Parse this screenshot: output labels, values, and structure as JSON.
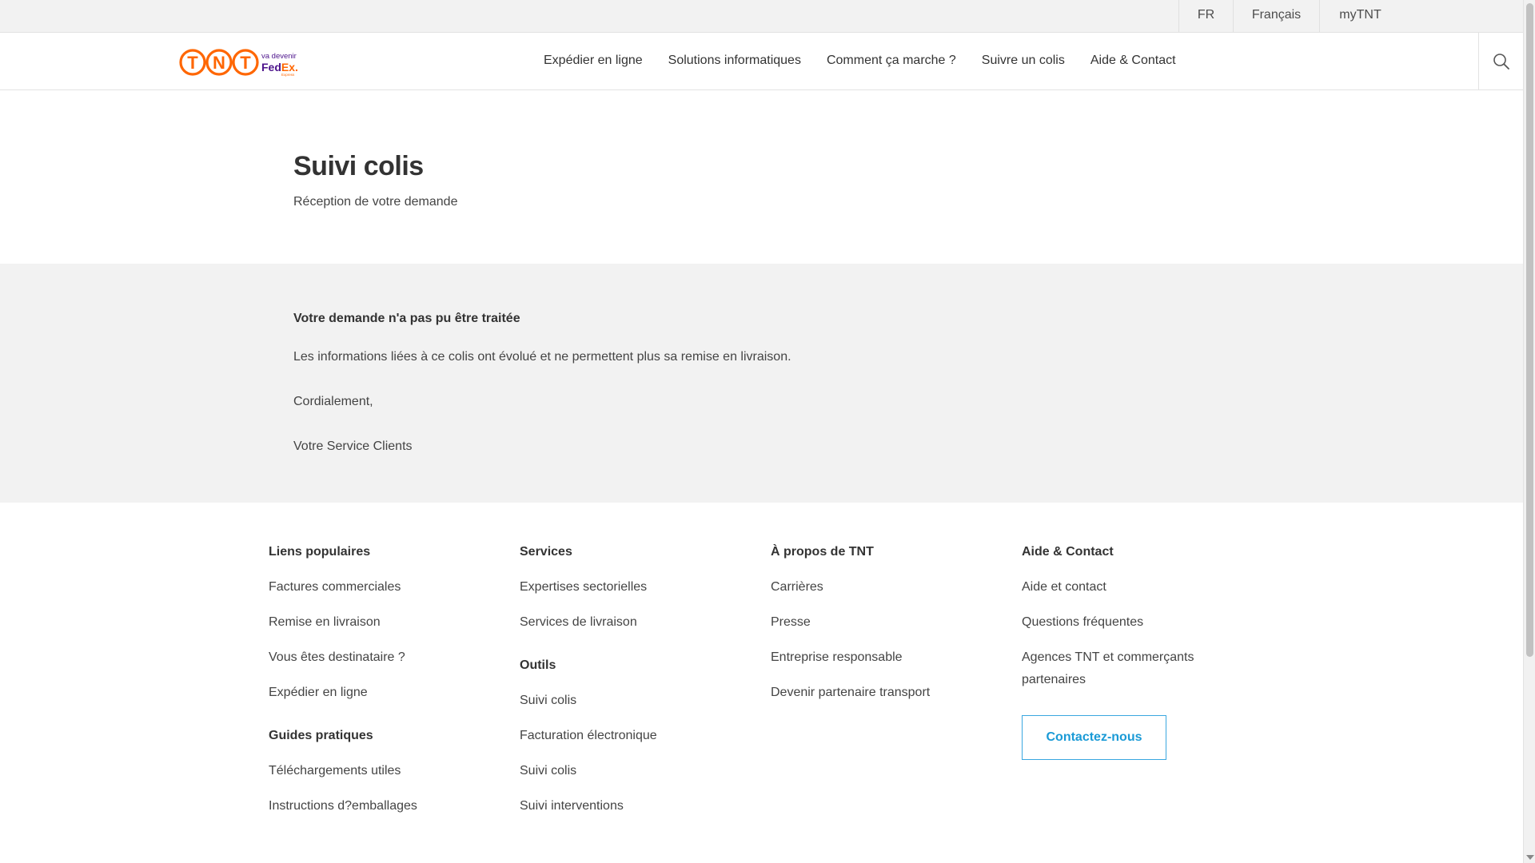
{
  "utility": {
    "country": "FR",
    "language": "Français",
    "account": "myTNT"
  },
  "header": {
    "logo": {
      "brand_text": "TNT",
      "tagline": "va devenir",
      "partner": "FedEx",
      "partner_sub": "Express"
    },
    "nav": [
      {
        "label": "Expédier en ligne"
      },
      {
        "label": "Solutions informatiques"
      },
      {
        "label": "Comment ça marche ?"
      },
      {
        "label": "Suivre un colis"
      },
      {
        "label": "Aide & Contact"
      }
    ],
    "search_icon": "search-icon"
  },
  "page": {
    "title": "Suivi colis",
    "subtitle": "Réception de votre demande"
  },
  "message": {
    "title": "Votre demande n'a pas pu être traitée",
    "text": "Les informations liées à ce colis ont évolué et ne permettent plus sa remise en livraison.",
    "greeting": "Cordialement,",
    "signature": "Votre Service Clients"
  },
  "footer": {
    "col1": {
      "heading": "Liens populaires",
      "links": [
        "Factures commerciales",
        "Remise en livraison",
        "Vous êtes destinataire ?",
        "Expédier en ligne"
      ],
      "heading2": "Guides pratiques",
      "links2": [
        "Téléchargements utiles",
        "Instructions d?emballages"
      ]
    },
    "col2": {
      "heading": "Services",
      "links": [
        "Expertises sectorielles",
        "Services de livraison"
      ],
      "heading2": "Outils",
      "links2": [
        "Suivi colis",
        "Facturation électronique",
        "Suivi colis",
        "Suivi interventions"
      ]
    },
    "col3": {
      "heading": "À propos de TNT",
      "links": [
        "Carrières",
        "Presse",
        "Entreprise responsable",
        "Devenir partenaire transport"
      ]
    },
    "col4": {
      "heading": "Aide & Contact",
      "links": [
        "Aide et contact",
        "Questions fréquentes",
        "Agences TNT et commerçants partenaires"
      ],
      "button": "Contactez-nous"
    }
  },
  "colors": {
    "tnt_orange": "#ff6600",
    "fedex_purple": "#4d148c",
    "fedex_orange": "#ff6600",
    "button_blue": "#1a9ad6",
    "gray_band": "#f2f2f2"
  }
}
